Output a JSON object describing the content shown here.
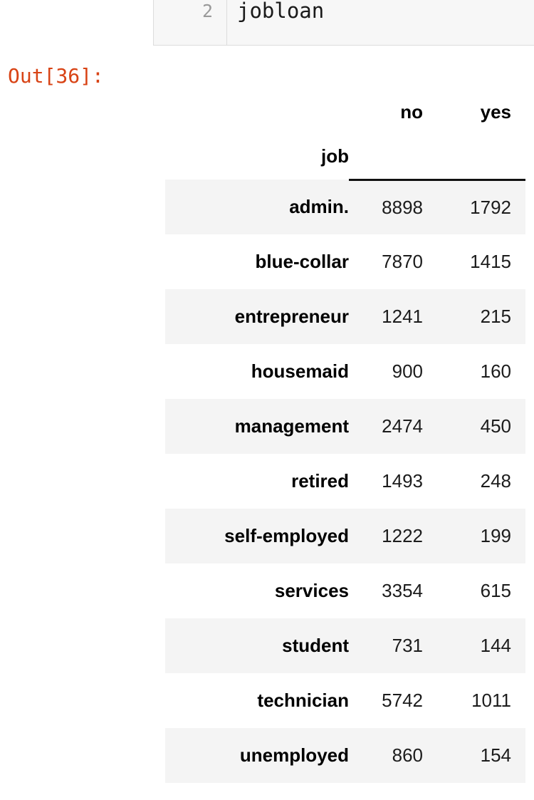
{
  "notebook": {
    "code_cell": {
      "line_number": "2",
      "source": "jobloan"
    },
    "output_prompt": "Out[36]:"
  },
  "table": {
    "index_name": "job",
    "columns": [
      "no",
      "yes"
    ],
    "rows": [
      {
        "label": "admin.",
        "no": "8898",
        "yes": "1792"
      },
      {
        "label": "blue-collar",
        "no": "7870",
        "yes": "1415"
      },
      {
        "label": "entrepreneur",
        "no": "1241",
        "yes": "215"
      },
      {
        "label": "housemaid",
        "no": "900",
        "yes": "160"
      },
      {
        "label": "management",
        "no": "2474",
        "yes": "450"
      },
      {
        "label": "retired",
        "no": "1493",
        "yes": "248"
      },
      {
        "label": "self-employed",
        "no": "1222",
        "yes": "199"
      },
      {
        "label": "services",
        "no": "3354",
        "yes": "615"
      },
      {
        "label": "student",
        "no": "731",
        "yes": "144"
      },
      {
        "label": "technician",
        "no": "5742",
        "yes": "1011"
      },
      {
        "label": "unemployed",
        "no": "860",
        "yes": "154"
      }
    ]
  },
  "colors": {
    "output_prompt": "#d84315",
    "row_stripe": "#f4f4f4",
    "header_rule": "#111111",
    "code_cell_bg": "#f7f7f7"
  }
}
